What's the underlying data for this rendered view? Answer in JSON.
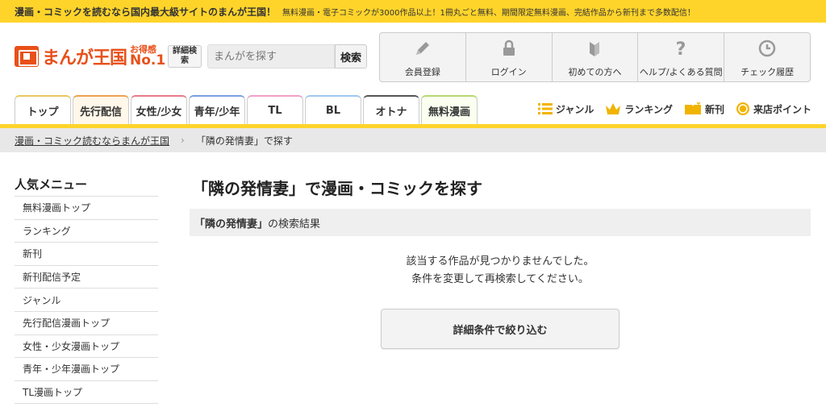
{
  "banner": {
    "main": "漫画・コミックを読むなら国内最大級サイトのまんが王国！",
    "sub": "無料漫画・電子コミックが3000作品以上！1冊丸ごと無料、期間限定無料漫画、完結作品から新刊まで多数配信！"
  },
  "logo": {
    "name": "まんが王国",
    "badge_small": "お得感",
    "badge_big": "No.1"
  },
  "search": {
    "detail_label": "詳細検索",
    "placeholder": "まんがを探す",
    "button": "検索"
  },
  "user_menu": [
    {
      "label": "会員登録",
      "icon": "pencil-icon"
    },
    {
      "label": "ログイン",
      "icon": "lock-icon"
    },
    {
      "label": "初めての方へ",
      "icon": "beginner-mark-icon"
    },
    {
      "label": "ヘルプ/よくある質問",
      "icon": "question-icon"
    },
    {
      "label": "チェック履歴",
      "icon": "clock-icon"
    }
  ],
  "tabs": [
    {
      "label": "トップ",
      "color": "#e8c860"
    },
    {
      "label": "先行配信",
      "color": "#f0a050"
    },
    {
      "label": "女性/少女",
      "color": "#e87a8a"
    },
    {
      "label": "青年/少年",
      "color": "#7aa0e0"
    },
    {
      "label": "TL",
      "color": "#f0a0c8"
    },
    {
      "label": "BL",
      "color": "#a0c8f0"
    },
    {
      "label": "オトナ",
      "color": "#555555"
    },
    {
      "label": "無料漫画",
      "color": "#b8d870"
    }
  ],
  "right_links": [
    {
      "label": "ジャンル",
      "icon": "list-icon"
    },
    {
      "label": "ランキング",
      "icon": "crown-icon"
    },
    {
      "label": "新刊",
      "icon": "book-icon"
    },
    {
      "label": "来店ポイント",
      "icon": "coin-icon"
    }
  ],
  "breadcrumb": {
    "home": "漫画・コミック読むならまんが王国",
    "current": "「隣の発情妻」で探す"
  },
  "sidebar": {
    "title": "人気メニュー",
    "items": [
      "無料漫画トップ",
      "ランキング",
      "新刊",
      "新刊配信予定",
      "ジャンル",
      "先行配信漫画トップ",
      "女性・少女漫画トップ",
      "青年・少年漫画トップ",
      "TL漫画トップ"
    ]
  },
  "main": {
    "title": "「隣の発情妻」で漫画・コミックを探す",
    "result_keyword": "「隣の発情妻」",
    "result_suffix": "の検索結果",
    "msg_line1": "該当する作品が見つかりませんでした。",
    "msg_line2": "条件を変更して再検索してください。",
    "refine_button": "詳細条件で絞り込む"
  },
  "colors": {
    "brand_yellow": "#ffd42a",
    "brand_orange": "#e8501a"
  }
}
